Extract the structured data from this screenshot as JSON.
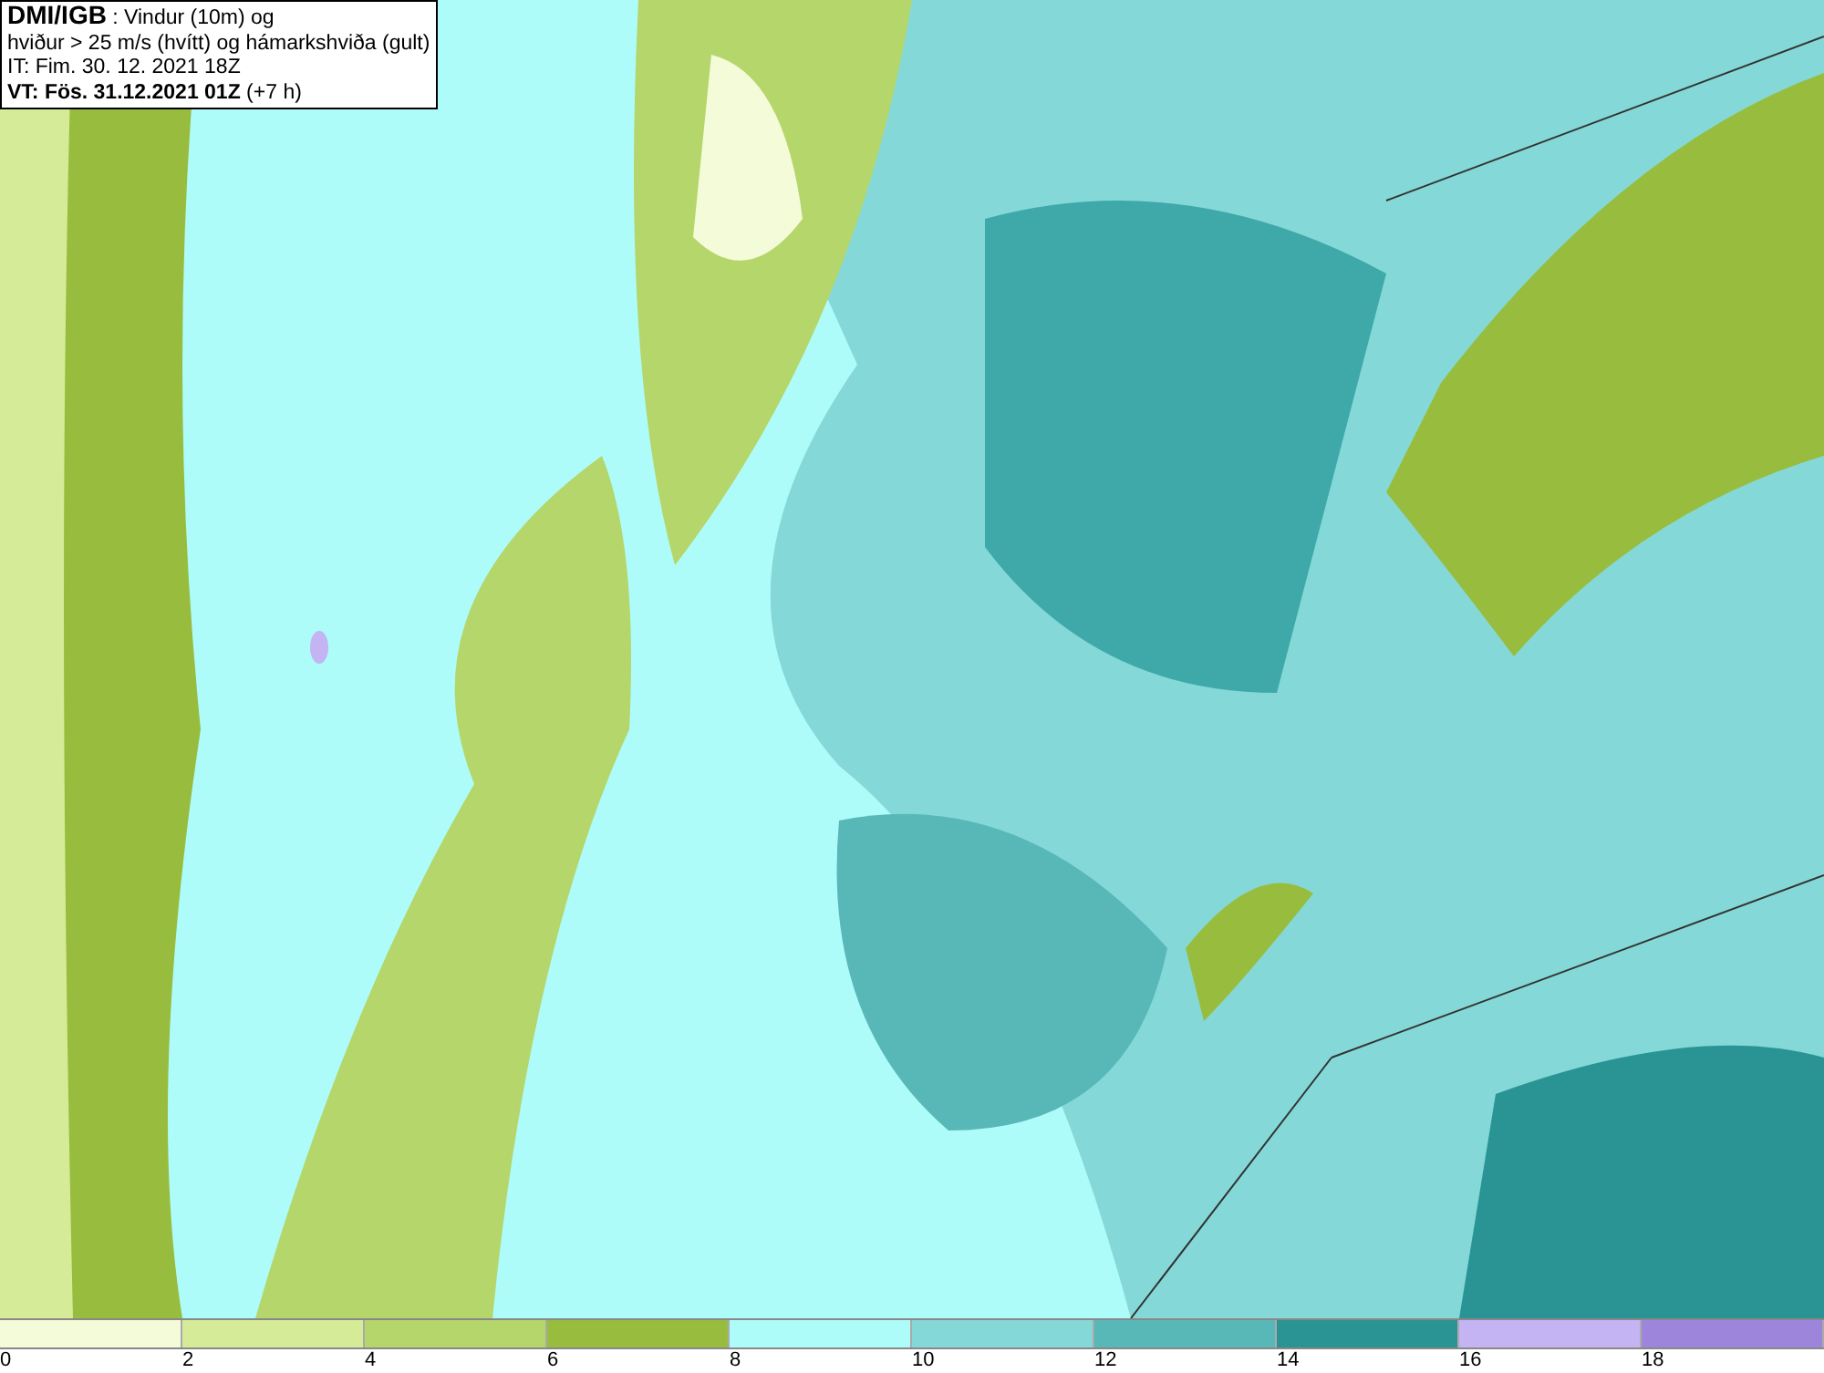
{
  "title_lines": [
    "**DMI/IGB** : Vindur (10m) og",
    "hviður > 25 m/s (hvítt) og hámarkshviða (gult)",
    "IT: Fim. 30. 12. 2021 18Z",
    "**VT: Fös. 31.12.2021 01Z** (+7 h)"
  ],
  "legend": {
    "bins": [
      {
        "color": "#f4fbd8"
      },
      {
        "color": "#d6eb98"
      },
      {
        "color": "#b5d66a"
      },
      {
        "color": "#98bd3e"
      },
      {
        "color": "#aefcfa"
      },
      {
        "color": "#84d9d8"
      },
      {
        "color": "#58b8b8"
      },
      {
        "color": "#2a9494"
      },
      {
        "color": "#c4b4f4"
      },
      {
        "color": "#9d85dc"
      }
    ],
    "ticks": [
      "0",
      "2",
      "4",
      "6",
      "8",
      "10",
      "12",
      "14",
      "16",
      "18"
    ]
  }
}
